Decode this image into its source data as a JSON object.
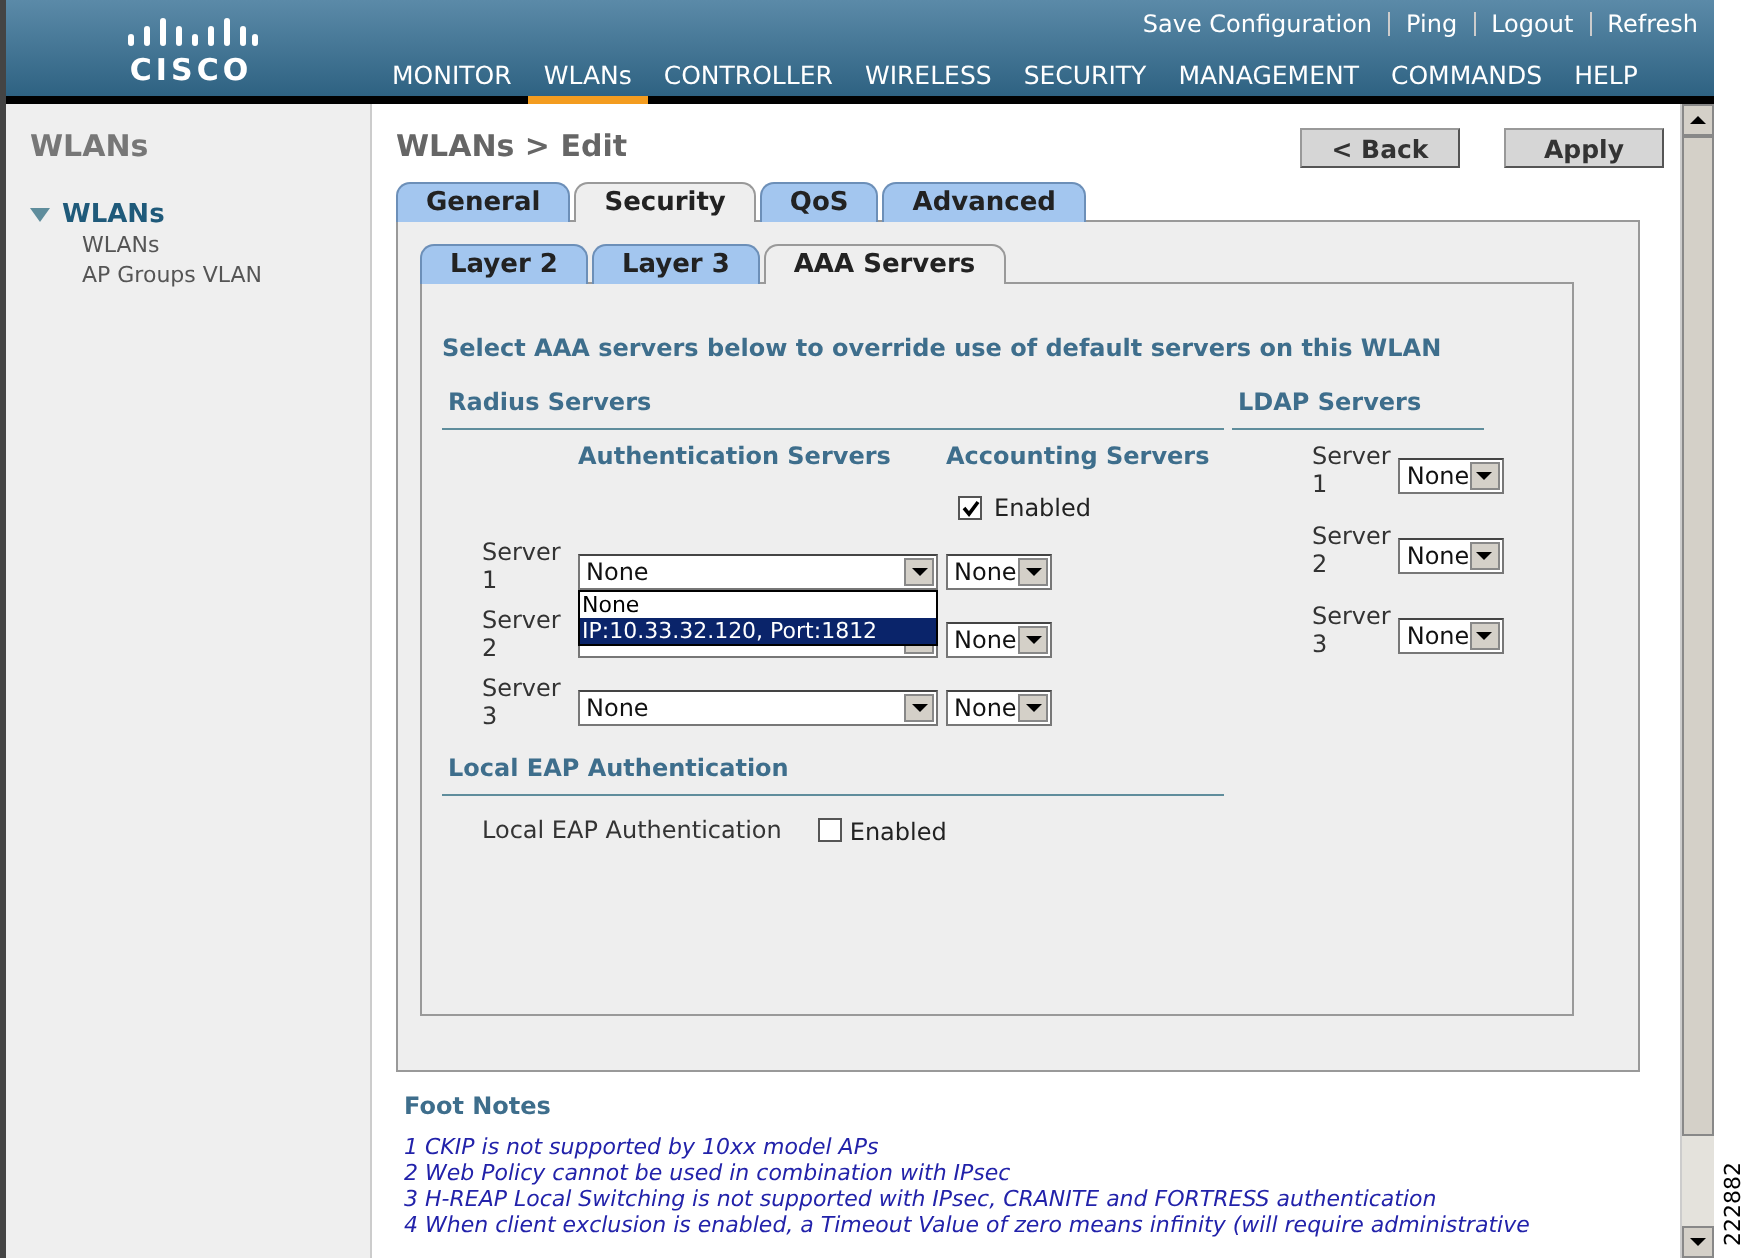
{
  "header": {
    "logo_text": "CISCO",
    "links": [
      "Save Configuration",
      "Ping",
      "Logout",
      "Refresh"
    ],
    "nav": [
      {
        "label": "MONITOR",
        "selected": false
      },
      {
        "label": "WLANs",
        "selected": true
      },
      {
        "label": "CONTROLLER",
        "selected": false
      },
      {
        "label": "WIRELESS",
        "selected": false
      },
      {
        "label": "SECURITY",
        "selected": false
      },
      {
        "label": "MANAGEMENT",
        "selected": false
      },
      {
        "label": "COMMANDS",
        "selected": false
      },
      {
        "label": "HELP",
        "selected": false
      }
    ]
  },
  "sidebar": {
    "title": "WLANs",
    "items": [
      {
        "label": "WLANs",
        "expanded": true,
        "children": [
          {
            "label": "WLANs"
          },
          {
            "label": "AP Groups VLAN"
          }
        ]
      }
    ]
  },
  "page": {
    "title": "WLANs > Edit",
    "buttons": [
      "< Back",
      "Apply"
    ]
  },
  "tabs": [
    {
      "label": "General",
      "selected": false
    },
    {
      "label": "Security",
      "selected": true
    },
    {
      "label": "QoS",
      "selected": false
    },
    {
      "label": "Advanced",
      "selected": false
    }
  ],
  "subtabs": [
    {
      "label": "Layer 2",
      "selected": false
    },
    {
      "label": "Layer 3",
      "selected": false
    },
    {
      "label": "AAA Servers",
      "selected": true
    }
  ],
  "intro": "Select AAA servers below to override use of default servers on this WLAN",
  "radius": {
    "title": "Radius Servers",
    "auth_heading": "Authentication Servers",
    "acct_heading": "Accounting Servers",
    "acct_enabled": {
      "label": "Enabled",
      "checked": true
    },
    "rows": [
      {
        "label": "Server 1",
        "auth": "None",
        "acct": "None"
      },
      {
        "label": "Server 2",
        "acct": "None"
      },
      {
        "label": "Server 3",
        "auth": "None",
        "acct": "None"
      }
    ],
    "open_list": {
      "options": [
        {
          "label": "None",
          "selected": false
        },
        {
          "label": "IP:10.33.32.120, Port:1812",
          "selected": true
        }
      ]
    }
  },
  "ldap": {
    "title": "LDAP Servers",
    "rows": [
      {
        "label": "Server 1",
        "value": "None"
      },
      {
        "label": "Server 2",
        "value": "None"
      },
      {
        "label": "Server 3",
        "value": "None"
      }
    ]
  },
  "local_eap": {
    "title": "Local EAP Authentication",
    "label": "Local EAP Authentication",
    "option": {
      "label": "Enabled",
      "checked": false
    }
  },
  "footnotes": {
    "title": "Foot Notes",
    "items": [
      "1 CKIP is not supported by 10xx model APs",
      "2 Web Policy cannot be used in combination with IPsec",
      "3 H-REAP Local Switching is not supported with IPsec, CRANITE and FORTRESS authentication",
      "4 When client exclusion is enabled, a Timeout Value of zero means infinity (will require administrative"
    ]
  },
  "figure_id": "222882"
}
